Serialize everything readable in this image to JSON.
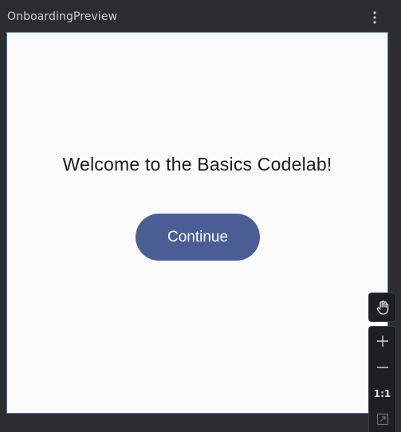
{
  "panel": {
    "title": "OnboardingPreview",
    "menu_icon": "more-vertical-icon"
  },
  "preview": {
    "welcome_text": "Welcome to the Basics Codelab!",
    "continue_label": "Continue",
    "background_color": "#fafafa",
    "button_color": "#4a5e95",
    "border_color": "#4b78c8"
  },
  "toolbar": {
    "pan_icon": "hand-icon",
    "zoom_in_icon": "plus-icon",
    "zoom_out_icon": "minus-icon",
    "actual_size_label": "1:1",
    "zoom_fit_icon": "zoom-to-fit-icon"
  }
}
